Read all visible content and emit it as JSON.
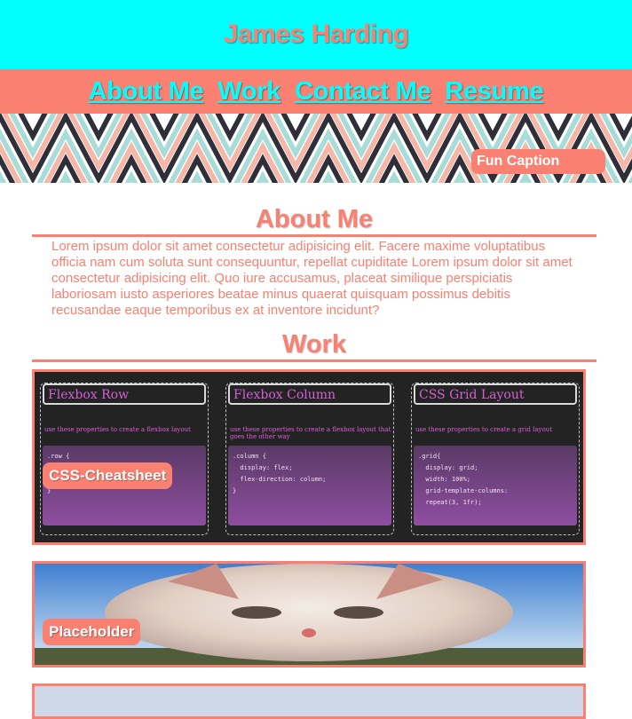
{
  "header": {
    "title": "James Harding"
  },
  "nav": {
    "items": [
      "About Me",
      "Work",
      "Contact Me",
      "Resume"
    ]
  },
  "hero": {
    "caption": "Fun Caption"
  },
  "about": {
    "heading": "About Me",
    "text": "Lorem ipsum dolor sit amet consectetur adipisicing elit. Facere maxime voluptatibus officia nam cum soluta sunt consequuntur, repellat cupiditate Lorem ipsum dolor sit amet consectetur adipisicing elit. Quo iure accusamus, placeat similique perspiciatis laboriosam iusto asperiores beatae minus quaerat quisquam possimus debitis recusandae eaque temporibus ex at inventore incidunt?"
  },
  "work": {
    "heading": "Work",
    "cards": [
      {
        "label": "CSS-Cheatsheet",
        "columns": [
          {
            "title": "Flexbox Row",
            "desc": "use these properties to create a flexbox layout",
            "code": ".row {\n\n  flex-wrap: wrap;\n}"
          },
          {
            "title": "Flexbox Column",
            "desc": "use these properties to create a flexbox layout that goes the other way",
            "code": ".column {\n  display: flex;\n  flex-direction: column;\n}"
          },
          {
            "title": "CSS Grid Layout",
            "desc": "use these properties to create a grid layout",
            "code": ".grid{\n  display: grid;\n  width: 100%;\n  grid-template-columns:\n  repeat(3, 1fr);"
          }
        ]
      },
      {
        "label": "Placeholder"
      }
    ]
  },
  "colors": {
    "accent": "#fa8072",
    "cyan": "#00ffff",
    "white": "#ffffff"
  }
}
